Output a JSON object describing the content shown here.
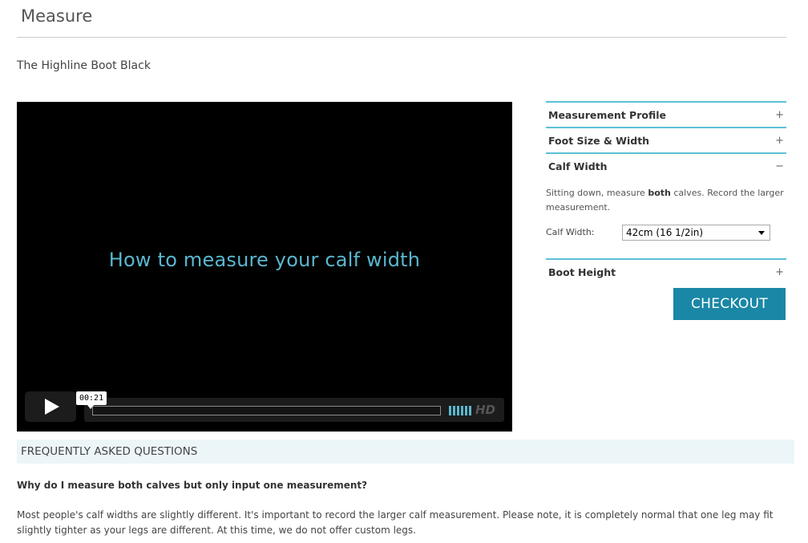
{
  "page": {
    "title": "Measure",
    "product_name": "The Highline Boot Black"
  },
  "video": {
    "caption": "How to measure your calf width",
    "time": "00:21",
    "hd_label": "HD"
  },
  "accordion": {
    "measurement_profile": "Measurement Profile",
    "foot_size": "Foot Size & Width",
    "calf_width": "Calf Width",
    "calf_desc_before": "Sitting down, measure ",
    "calf_desc_bold": "both",
    "calf_desc_after": " calves. Record the larger measurement.",
    "calf_label": "Calf Width:",
    "calf_value": "42cm (16 1/2in)",
    "boot_height": "Boot Height",
    "expand_symbol": "+",
    "collapse_symbol": "−"
  },
  "checkout_label": "CHECKOUT",
  "faq": {
    "header": "FREQUENTLY ASKED QUESTIONS",
    "question": "Why do I measure both calves but only input one measurement?",
    "answer": "Most people's calf widths are slightly different. It's important to record the larger calf measurement. Please note, it is completely normal that one leg may fit slightly tighter as your legs are different. At this time, we do not offer custom legs."
  },
  "colors": {
    "accent": "#5bc1d6",
    "checkout": "#1a87a6",
    "caption": "#5ab7d0",
    "faq_bg": "#ecf6f9"
  },
  "icons": [
    "play-icon",
    "volume-icon",
    "chevron-down-icon"
  ]
}
